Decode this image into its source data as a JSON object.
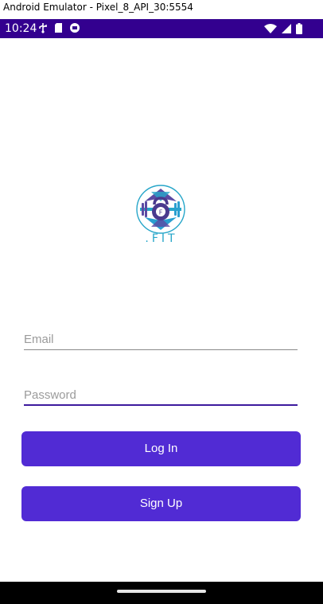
{
  "window": {
    "title": "Android Emulator - Pixel_8_API_30:5554"
  },
  "status_bar": {
    "time": "10:24",
    "background": "#33008f",
    "left_icons": [
      "usb-debug-icon",
      "sd-card-icon",
      "sync-icon"
    ],
    "right_icons": [
      "wifi-icon",
      "signal-icon",
      "battery-icon"
    ]
  },
  "logo": {
    "icon": "kettlebell-logo-icon",
    "text": ".FIT",
    "text_color": "#27a6c9"
  },
  "form": {
    "email": {
      "value": "",
      "placeholder": "Email"
    },
    "password": {
      "value": "",
      "placeholder": "Password"
    }
  },
  "buttons": {
    "login_label": "Log In",
    "signup_label": "Sign Up",
    "color": "#512bd4"
  },
  "nav_bar": {
    "handle": "home-gesture-handle"
  }
}
